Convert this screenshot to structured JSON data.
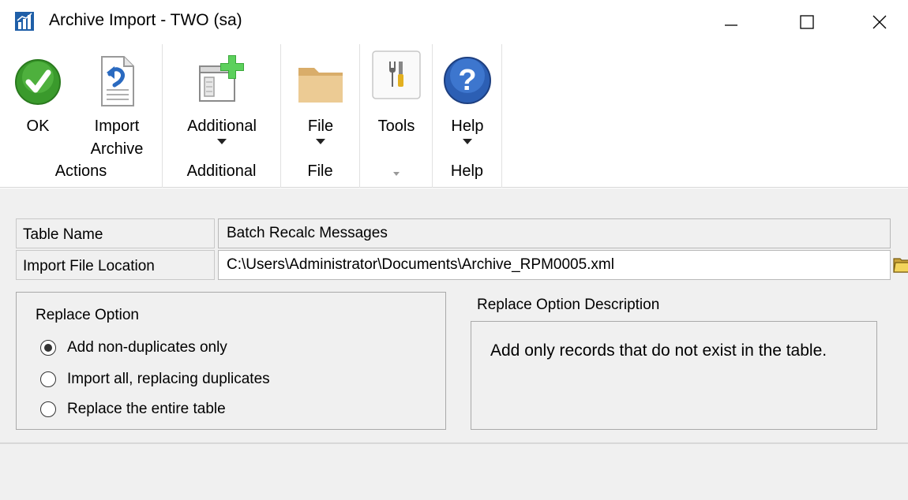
{
  "window": {
    "title": "Archive Import  -  TWO (sa)",
    "app_icon": "bar-chart-icon",
    "controls": [
      "minimize-icon",
      "maximize-icon",
      "close-icon"
    ]
  },
  "ribbon": {
    "groups": [
      {
        "label": "Actions",
        "buttons": [
          {
            "label": "OK",
            "icon": "check-icon"
          },
          {
            "label": "Import Archive",
            "icon": "document-import-icon"
          }
        ]
      },
      {
        "label": "Additional",
        "buttons": [
          {
            "label": "Additional",
            "icon": "window-add-icon"
          }
        ]
      },
      {
        "label": "File",
        "buttons": [
          {
            "label": "File",
            "icon": "folder-icon"
          }
        ]
      },
      {
        "label": "",
        "buttons": [
          {
            "label": "Tools",
            "icon": "tools-icon"
          }
        ]
      },
      {
        "label": "Help",
        "buttons": [
          {
            "label": "Help",
            "icon": "help-icon"
          }
        ]
      }
    ]
  },
  "form": {
    "table_name_label": "Table Name",
    "table_name_value": "Batch Recalc Messages",
    "import_file_label": "Import File Location",
    "import_file_value": "C:\\Users\\Administrator\\Documents\\Archive_RPM0005.xml"
  },
  "replace_option": {
    "title": "Replace Option",
    "options": [
      {
        "label": "Add non-duplicates only",
        "selected": true
      },
      {
        "label": "Import all, replacing duplicates",
        "selected": false
      },
      {
        "label": "Replace the entire table",
        "selected": false
      }
    ]
  },
  "description": {
    "title": "Replace Option Description",
    "text": "Add only records that do not exist in the table."
  },
  "colors": {
    "ok_green": "#3a9a2c",
    "help_blue": "#2c5fb4",
    "folder_tan": "#e8c890"
  }
}
